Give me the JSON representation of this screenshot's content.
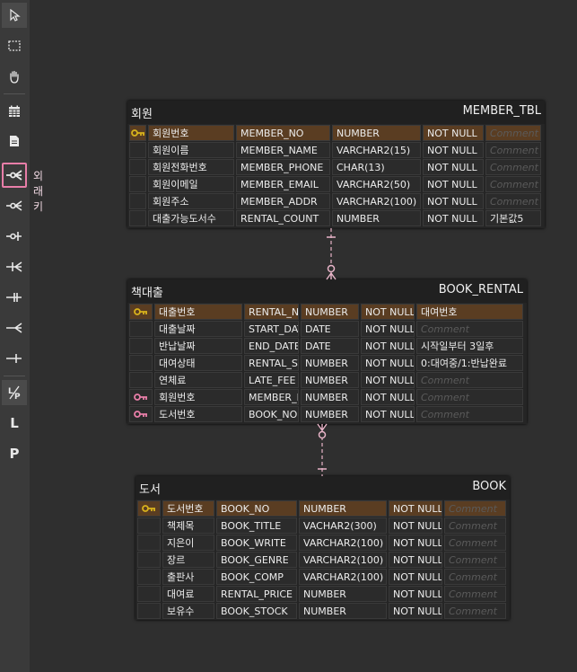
{
  "toolbar": {
    "tools": [
      {
        "icon": "pointer-icon"
      },
      {
        "icon": "marquee-select-icon"
      },
      {
        "icon": "hand-pan-icon"
      },
      {
        "icon": "new-table-icon"
      },
      {
        "icon": "new-note-icon"
      },
      {
        "icon": "foreign-key-icon"
      },
      {
        "icon": "zero-or-many-relation-icon"
      },
      {
        "icon": "zero-or-one-relation-icon"
      },
      {
        "icon": "one-or-many-relation-icon"
      },
      {
        "icon": "one-only-relation-icon"
      },
      {
        "icon": "many-relation-icon"
      },
      {
        "icon": "one-relation-icon"
      },
      {
        "icon": "logical-physical-icon"
      },
      {
        "icon": "logical-mode-icon",
        "label": "L"
      },
      {
        "icon": "physical-mode-icon",
        "label": "P"
      }
    ],
    "active_tooltip": "외래키"
  },
  "colors": {
    "accent": "#e87ea8",
    "pk_row": "#5a3d22",
    "key": "#d8b21c",
    "fk_key": "#e87ea8"
  },
  "placeholder": "Comment",
  "tables": [
    {
      "name": "회원",
      "physical": "MEMBER_TBL",
      "rows": [
        {
          "key": "pk",
          "logical": "회원번호",
          "physical": "MEMBER_NO",
          "type": "NUMBER",
          "nullable": "NOT NULL",
          "comment": ""
        },
        {
          "key": "",
          "logical": "회원이름",
          "physical": "MEMBER_NAME",
          "type": "VARCHAR2(15)",
          "nullable": "NOT NULL",
          "comment": ""
        },
        {
          "key": "",
          "logical": "회원전화번호",
          "physical": "MEMBER_PHONE",
          "type": "CHAR(13)",
          "nullable": "NOT NULL",
          "comment": ""
        },
        {
          "key": "",
          "logical": "회원이메일",
          "physical": "MEMBER_EMAIL",
          "type": "VARCHAR2(50)",
          "nullable": "NOT NULL",
          "comment": ""
        },
        {
          "key": "",
          "logical": "회원주소",
          "physical": "MEMBER_ADDR",
          "type": "VARCHAR2(100)",
          "nullable": "NOT NULL",
          "comment": ""
        },
        {
          "key": "",
          "logical": "대출가능도서수",
          "physical": "RENTAL_COUNT",
          "type": "NUMBER",
          "nullable": "NOT NULL",
          "comment": "기본값5"
        }
      ]
    },
    {
      "name": "책대출",
      "physical": "BOOK_RENTAL",
      "rows": [
        {
          "key": "pk",
          "logical": "대출번호",
          "physical": "RENTAL_NO",
          "type": "NUMBER",
          "nullable": "NOT NULL",
          "comment": "대여번호"
        },
        {
          "key": "",
          "logical": "대출날짜",
          "physical": "START_DATE",
          "type": "DATE",
          "nullable": "NOT NULL",
          "comment": ""
        },
        {
          "key": "",
          "logical": "반납날짜",
          "physical": "END_DATE",
          "type": "DATE",
          "nullable": "NOT NULL",
          "comment": "시작일부터 3일후"
        },
        {
          "key": "",
          "logical": "대여상태",
          "physical": "RENTAL_STATUS",
          "type": "NUMBER",
          "nullable": "NOT NULL",
          "comment": "0:대여중/1:반납완료"
        },
        {
          "key": "",
          "logical": "연체료",
          "physical": "LATE_FEE",
          "type": "NUMBER",
          "nullable": "NOT NULL",
          "comment": ""
        },
        {
          "key": "fk",
          "logical": "회원번호",
          "physical": "MEMBER_NO",
          "type": "NUMBER",
          "nullable": "NOT NULL",
          "comment": ""
        },
        {
          "key": "fk",
          "logical": "도서번호",
          "physical": "BOOK_NO",
          "type": "NUMBER",
          "nullable": "NOT NULL",
          "comment": ""
        }
      ]
    },
    {
      "name": "도서",
      "physical": "BOOK",
      "rows": [
        {
          "key": "pk",
          "logical": "도서번호",
          "physical": "BOOK_NO",
          "type": "NUMBER",
          "nullable": "NOT NULL",
          "comment": ""
        },
        {
          "key": "",
          "logical": "책제목",
          "physical": "BOOK_TITLE",
          "type": "VACHAR2(300)",
          "nullable": "NOT NULL",
          "comment": ""
        },
        {
          "key": "",
          "logical": "지은이",
          "physical": "BOOK_WRITE",
          "type": "VARCHAR2(100)",
          "nullable": "NOT NULL",
          "comment": ""
        },
        {
          "key": "",
          "logical": "장르",
          "physical": "BOOK_GENRE",
          "type": "VARCHAR2(100)",
          "nullable": "NOT NULL",
          "comment": ""
        },
        {
          "key": "",
          "logical": "출판사",
          "physical": "BOOK_COMP",
          "type": "VARCHAR2(100)",
          "nullable": "NOT NULL",
          "comment": ""
        },
        {
          "key": "",
          "logical": "대여료",
          "physical": "RENTAL_PRICE",
          "type": "NUMBER",
          "nullable": "NOT NULL",
          "comment": ""
        },
        {
          "key": "",
          "logical": "보유수",
          "physical": "BOOK_STOCK",
          "type": "NUMBER",
          "nullable": "NOT NULL",
          "comment": ""
        }
      ]
    }
  ]
}
